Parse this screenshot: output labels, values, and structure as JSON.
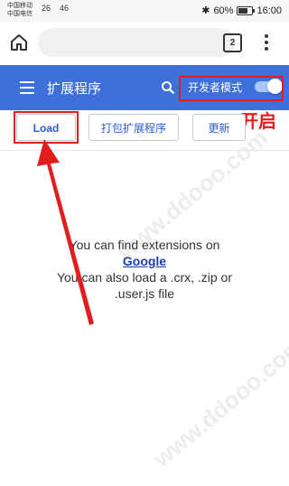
{
  "status_bar": {
    "carrier_1": "中国移动",
    "carrier_2": "中国电信",
    "signal_1": "26",
    "signal_2": "46",
    "battery": "60%",
    "time": "16:00"
  },
  "browser": {
    "tab_count": "2"
  },
  "app_bar": {
    "title": "扩展程序",
    "dev_mode_label": "开发者模式",
    "dev_mode_on": true,
    "accent_color": "#3f6fd8"
  },
  "annotation": {
    "label": "开启",
    "color": "#e21d1d"
  },
  "actions": {
    "load": "Load",
    "pack": "打包扩展程序",
    "update": "更新"
  },
  "empty_state": {
    "line1": "You can find extensions on",
    "link": "Google",
    "line2": "You can also load a .crx, .zip or",
    "line3": ".user.js file"
  }
}
